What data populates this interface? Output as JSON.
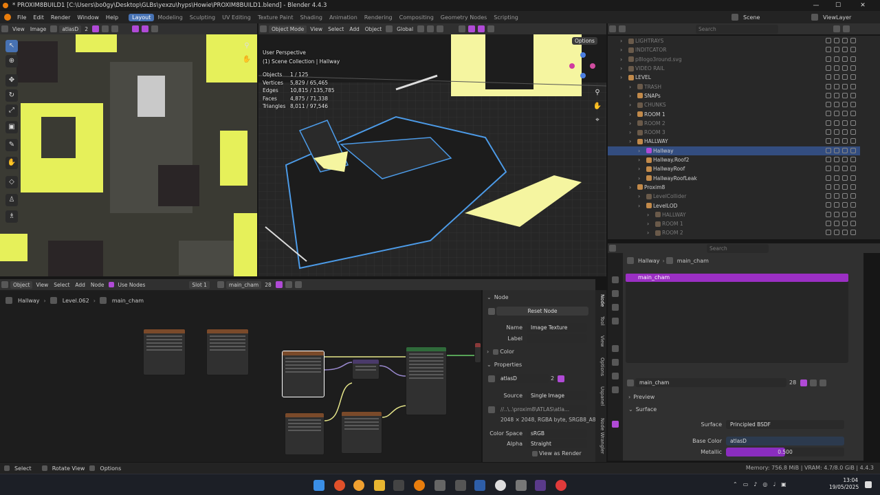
{
  "window": {
    "title": "* PROXIM8BUILD1 [C:\\Users\\bo0gy\\Desktop\\GLBs\\yexzu\\hyps\\Howie\\PROXIM8BUILD1.blend] - Blender 4.4.3",
    "min": "—",
    "max": "☐",
    "close": "✕"
  },
  "menu": [
    "File",
    "Edit",
    "Render",
    "Window",
    "Help"
  ],
  "workspaces": [
    "Layout",
    "Modeling",
    "Sculpting",
    "UV Editing",
    "Texture Paint",
    "Shading",
    "Animation",
    "Rendering",
    "Compositing",
    "Geometry Nodes",
    "Scripting"
  ],
  "active_workspace": "Layout",
  "scene": {
    "label": "Scene",
    "view_layer": "ViewLayer"
  },
  "image_editor": {
    "view": "View",
    "image": "Image",
    "image_name": "atlasD",
    "users": "2"
  },
  "viewport": {
    "mode": "Object Mode",
    "menus": [
      "View",
      "Select",
      "Add",
      "Object"
    ],
    "orientation": "Global",
    "options": "Options",
    "overlay_title": "User Perspective",
    "overlay_collection": "(1) Scene Collection | Hallway",
    "stats": [
      {
        "label": "Objects",
        "value": "1 / 125"
      },
      {
        "label": "Vertices",
        "value": "5,829 / 65,465"
      },
      {
        "label": "Edges",
        "value": "10,815 / 135,785"
      },
      {
        "label": "Faces",
        "value": "4,875 / 71,338"
      },
      {
        "label": "Triangles",
        "value": "8,011 / 97,546"
      }
    ]
  },
  "outliner": {
    "search_placeholder": "Search",
    "rows": [
      {
        "label": "LIGHTRAYS",
        "indent": 0,
        "dim": true,
        "sel": false
      },
      {
        "label": "INDITCATOR",
        "indent": 0,
        "dim": true,
        "sel": false
      },
      {
        "label": "p8logo3round.svg",
        "indent": 0,
        "dim": true,
        "sel": false
      },
      {
        "label": "VIDEO RAIL",
        "indent": 0,
        "dim": true,
        "sel": false
      },
      {
        "label": "LEVEL",
        "indent": 0,
        "dim": false,
        "sel": false
      },
      {
        "label": "TRASH",
        "indent": 1,
        "dim": true,
        "sel": false
      },
      {
        "label": "SNAPs",
        "indent": 1,
        "dim": false,
        "sel": false
      },
      {
        "label": "CHUNKS",
        "indent": 1,
        "dim": true,
        "sel": false
      },
      {
        "label": "ROOM 1",
        "indent": 1,
        "dim": false,
        "sel": false
      },
      {
        "label": "ROOM 2",
        "indent": 1,
        "dim": true,
        "sel": false
      },
      {
        "label": "ROOM 3",
        "indent": 1,
        "dim": true,
        "sel": false
      },
      {
        "label": "HALLWAY",
        "indent": 1,
        "dim": false,
        "sel": false
      },
      {
        "label": "Hallway",
        "indent": 2,
        "dim": false,
        "sel": true
      },
      {
        "label": "Hallway.Roof2",
        "indent": 2,
        "dim": false,
        "sel": false
      },
      {
        "label": "HallwayRoof",
        "indent": 2,
        "dim": false,
        "sel": false
      },
      {
        "label": "HallwayRoofLeak",
        "indent": 2,
        "dim": false,
        "sel": false
      },
      {
        "label": "Proxim8",
        "indent": 1,
        "dim": false,
        "sel": false
      },
      {
        "label": "LevelCollider",
        "indent": 2,
        "dim": true,
        "sel": false
      },
      {
        "label": "LevelLOD",
        "indent": 2,
        "dim": false,
        "sel": false
      },
      {
        "label": "HALLWAY",
        "indent": 3,
        "dim": true,
        "sel": false
      },
      {
        "label": "ROOM 1",
        "indent": 3,
        "dim": true,
        "sel": false
      },
      {
        "label": "ROOM 2",
        "indent": 3,
        "dim": true,
        "sel": false
      }
    ]
  },
  "properties": {
    "search_placeholder": "Search",
    "breadcrumb": [
      "Hallway",
      "main_cham"
    ],
    "material_slot": "main_cham",
    "material_name": "main_cham",
    "material_users": "28",
    "preview": "Preview",
    "surface_section": "Surface",
    "surface_label": "Surface",
    "surface_value": "Principled BSDF",
    "base_color_label": "Base Color",
    "base_color_value": "atlasD",
    "metallic_label": "Metallic",
    "metallic_value": "0.500",
    "metallic_fraction": 0.5
  },
  "node_editor": {
    "object": "Object",
    "menus": [
      "View",
      "Select",
      "Add",
      "Node"
    ],
    "use_nodes": "Use Nodes",
    "slot": "Slot 1",
    "material": "main_cham",
    "users": "28",
    "breadcrumb": [
      "Hallway",
      "Level.062",
      "main_cham"
    ]
  },
  "node_panel": {
    "node_title": "Node",
    "reset": "Reset Node",
    "name_label": "Name",
    "name_value": "Image Texture",
    "label_label": "Label",
    "color_label": "Color",
    "properties_title": "Properties",
    "image_name": "atlasD",
    "image_users": "2",
    "source_label": "Source",
    "source_value": "Single Image",
    "path": "//..\\..\\proxim8\\ATLAS\\atla...",
    "info": "2048 × 2048, RGBA byte, SRGB8_A8",
    "color_space_label": "Color Space",
    "color_space_value": "sRGB",
    "alpha_label": "Alpha",
    "alpha_value": "Straight",
    "view_as_render": "View as Render",
    "tabs": [
      "Node",
      "Tool",
      "View",
      "Options",
      "Uspanel",
      "Node Wrangler"
    ]
  },
  "status": {
    "select": "Select",
    "rotate": "Rotate View",
    "options": "Options",
    "memory": "Memory: 756.8 MiB | VRAM: 4.7/8.0 GiB | 4.4.3"
  },
  "taskbar": {
    "time": "13:04",
    "date": "19/05/2025"
  },
  "colors": {
    "accent_blue": "#4772b3",
    "accent_purple": "#b04ad6",
    "selection": "#334d80",
    "texture_yellow": "#e6f05a"
  }
}
